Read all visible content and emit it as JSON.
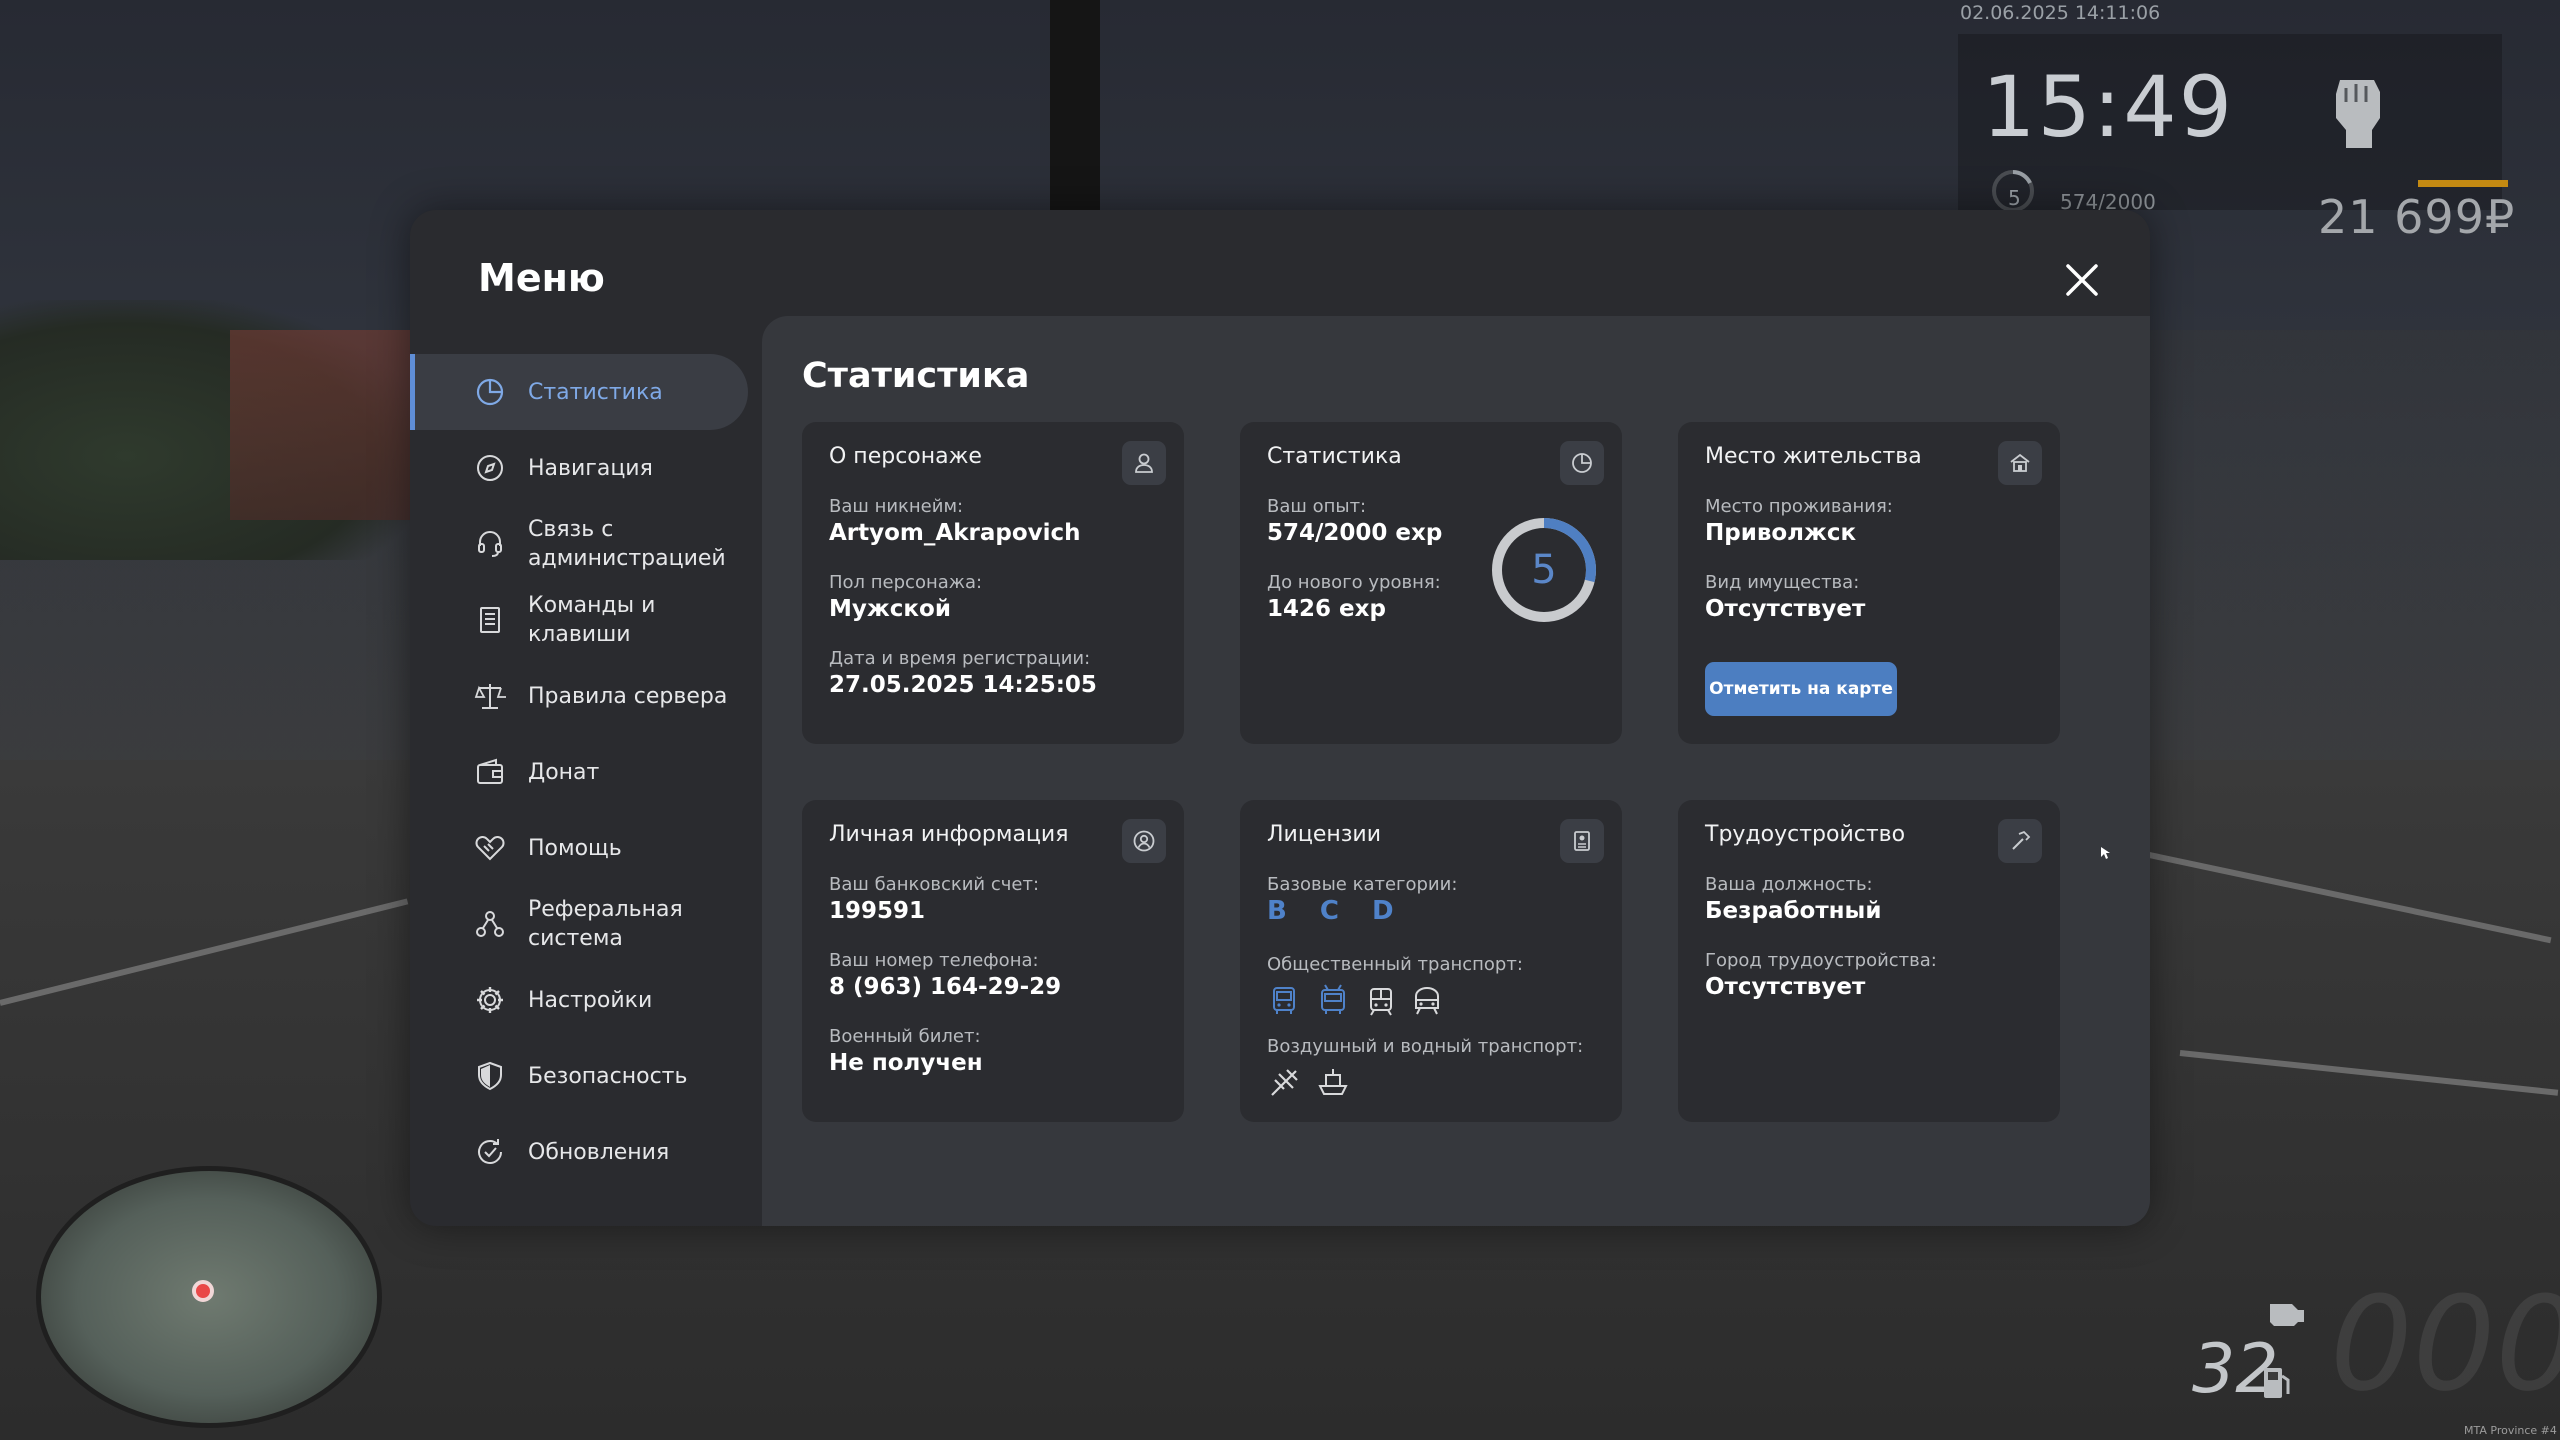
{
  "hud": {
    "datetime": "02.06.2025 14:11:06",
    "clock": "15:49",
    "level": "5",
    "exp": "574/2000",
    "money": "21 699₽"
  },
  "speedometer": {
    "speed": "32",
    "ghost": "000"
  },
  "watermark": "MTA Province #4",
  "menu": {
    "title": "Меню",
    "nav": [
      {
        "label": "Статистика",
        "icon": "pie-chart-icon",
        "active": true
      },
      {
        "label": "Навигация",
        "icon": "compass-icon"
      },
      {
        "label": "Связь с администрацией",
        "icon": "headset-icon"
      },
      {
        "label": "Команды и клавиши",
        "icon": "list-icon"
      },
      {
        "label": "Правила сервера",
        "icon": "scales-icon"
      },
      {
        "label": "Донат",
        "icon": "wallet-icon"
      },
      {
        "label": "Помощь",
        "icon": "handshake-icon"
      },
      {
        "label": "Реферальная система",
        "icon": "referral-icon"
      },
      {
        "label": "Настройки",
        "icon": "gear-icon"
      },
      {
        "label": "Безопасность",
        "icon": "shield-icon"
      },
      {
        "label": "Обновления",
        "icon": "refresh-check-icon"
      }
    ]
  },
  "stats": {
    "title": "Статистика",
    "character": {
      "title": "О персонаже",
      "nickname_label": "Ваш никнейм:",
      "nickname": "Artyom_Akrapovich",
      "gender_label": "Пол персонажа:",
      "gender": "Мужской",
      "reg_label": "Дата и время регистрации:",
      "reg": "27.05.2025 14:25:05"
    },
    "experience": {
      "title": "Статистика",
      "exp_label": "Ваш опыт:",
      "exp": "574/2000 exp",
      "next_label": "До нового уровня:",
      "next": "1426 exp",
      "level": "5",
      "progress": 0.287
    },
    "residence": {
      "title": "Место жительства",
      "place_label": "Место проживания:",
      "place": "Приволжск",
      "property_label": "Вид имущества:",
      "property": "Отсутствует",
      "button": "Отметить на карте"
    },
    "personal": {
      "title": "Личная информация",
      "bank_label": "Ваш банковский счет:",
      "bank": "199591",
      "phone_label": "Ваш номер телефона:",
      "phone": "8 (963) 164-29-29",
      "military_label": "Военный билет:",
      "military": "Не получен"
    },
    "licenses": {
      "title": "Лицензии",
      "base_label": "Базовые категории:",
      "base": "B C D",
      "public_label": "Общественный транспорт:",
      "public_icons": [
        "bus-icon",
        "trolleybus-icon",
        "tram-icon",
        "metro-icon"
      ],
      "air_label": "Воздушный и водный транспорт:",
      "air_icons": [
        "plane-icon",
        "boat-icon"
      ]
    },
    "employment": {
      "title": "Трудоустройство",
      "job_label": "Ваша должность:",
      "job": "Безработный",
      "city_label": "Город трудоустройства:",
      "city": "Отсутствует"
    }
  },
  "colors": {
    "accent": "#5f8ed6",
    "button": "#4c7ec1",
    "card": "#2b2c30",
    "content": "#36383d"
  }
}
